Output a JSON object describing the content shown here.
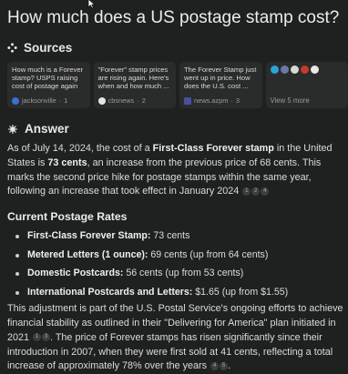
{
  "question": "How much does a US postage stamp cost?",
  "sources": {
    "heading": "Sources",
    "cards": [
      {
        "title": "How much is a Forever stamp? USPS raising cost of postage again",
        "source": "jacksonville",
        "num": "1",
        "color": "#3a6fd8"
      },
      {
        "title": "\"Forever\" stamp prices are rising again. Here's when and how much ...",
        "source": "cbsnews",
        "num": "2",
        "color": "#e6e6e6"
      },
      {
        "title": "The Forever Stamp just went up in price. How does the U.S. cost ...",
        "source": "news.azpm",
        "num": "3",
        "color": "#4b4f9c"
      }
    ],
    "more_label": "View 5 more",
    "more_icon_colors": [
      "#2aa4d8",
      "#6b78a8",
      "#d8d8d8",
      "#c83a2a",
      "#e8e8e8"
    ]
  },
  "answer": {
    "heading": "Answer",
    "p1_a": "As of July 14, 2024, the cost of a ",
    "p1_b": "First-Class Forever stamp",
    "p1_c": " in the United States is ",
    "p1_d": "73 cents",
    "p1_e": ", an increase from the previous price of 68 cents. This marks the second price hike for postage stamps within the same year, following an increase that took effect in January 2024",
    "p1_cites": [
      "1",
      "2",
      "4"
    ],
    "rates_heading": "Current Postage Rates",
    "rates": [
      {
        "label": "First-Class Forever Stamp:",
        "value": " 73 cents"
      },
      {
        "label": "Metered Letters (1 ounce):",
        "value": " 69 cents (up from 64 cents)"
      },
      {
        "label": "Domestic Postcards:",
        "value": " 56 cents (up from 53 cents)"
      },
      {
        "label": "International Postcards and Letters:",
        "value": " $1.65 (up from $1.55)"
      }
    ],
    "p2_a": "This adjustment is part of the U.S. Postal Service's ongoing efforts to achieve financial stability as outlined in their \"Delivering for America\" plan initiated in 2021",
    "p2_cites_a": [
      "1",
      "3"
    ],
    "p2_b": ". The price of Forever stamps has risen significantly since their introduction in 2007, when they were first sold at 41 cents, reflecting a total increase of approximately 78% over the years",
    "p2_cites_b": [
      "4",
      "5"
    ],
    "p2_c": "."
  }
}
